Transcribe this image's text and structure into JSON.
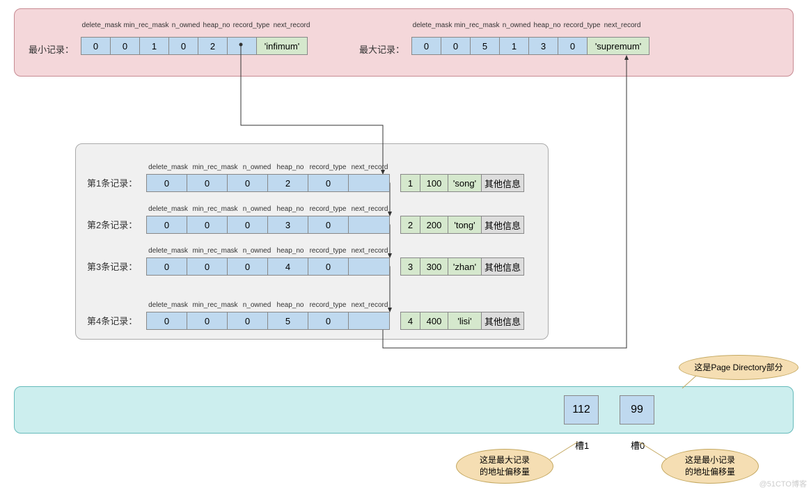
{
  "header_fields": [
    "delete_mask",
    "min_rec_mask",
    "n_owned",
    "heap_no",
    "record_type",
    "next_record"
  ],
  "top": {
    "min_label": "最小记录：",
    "max_label": "最大记录：",
    "min_cells": [
      "0",
      "0",
      "1",
      "0",
      "2",
      ""
    ],
    "min_value": "'infimum'",
    "max_cells": [
      "0",
      "0",
      "5",
      "1",
      "3",
      "0"
    ],
    "max_value": "'supremum'"
  },
  "rows": [
    {
      "label": "第1条记录：",
      "hdr": [
        "0",
        "0",
        "0",
        "2",
        "0",
        ""
      ],
      "data": [
        "1",
        "100",
        "'song'"
      ],
      "extra": "其他信息"
    },
    {
      "label": "第2条记录：",
      "hdr": [
        "0",
        "0",
        "0",
        "3",
        "0",
        ""
      ],
      "data": [
        "2",
        "200",
        "'tong'"
      ],
      "extra": "其他信息"
    },
    {
      "label": "第3条记录：",
      "hdr": [
        "0",
        "0",
        "0",
        "4",
        "0",
        ""
      ],
      "data": [
        "3",
        "300",
        "'zhan'"
      ],
      "extra": "其他信息"
    },
    {
      "label": "第4条记录：",
      "hdr": [
        "0",
        "0",
        "0",
        "5",
        "0",
        ""
      ],
      "data": [
        "4",
        "400",
        "'lisi'"
      ],
      "extra": "其他信息"
    }
  ],
  "slots": {
    "s1": "112",
    "s0": "99",
    "s1_label": "槽1",
    "s0_label": "槽0"
  },
  "callouts": {
    "page_dir": "这是Page Directory部分",
    "max_offset": "这是最大记录\n的地址偏移量",
    "min_offset": "这是最小记录\n的地址偏移量"
  },
  "watermark": "@51CTO博客"
}
